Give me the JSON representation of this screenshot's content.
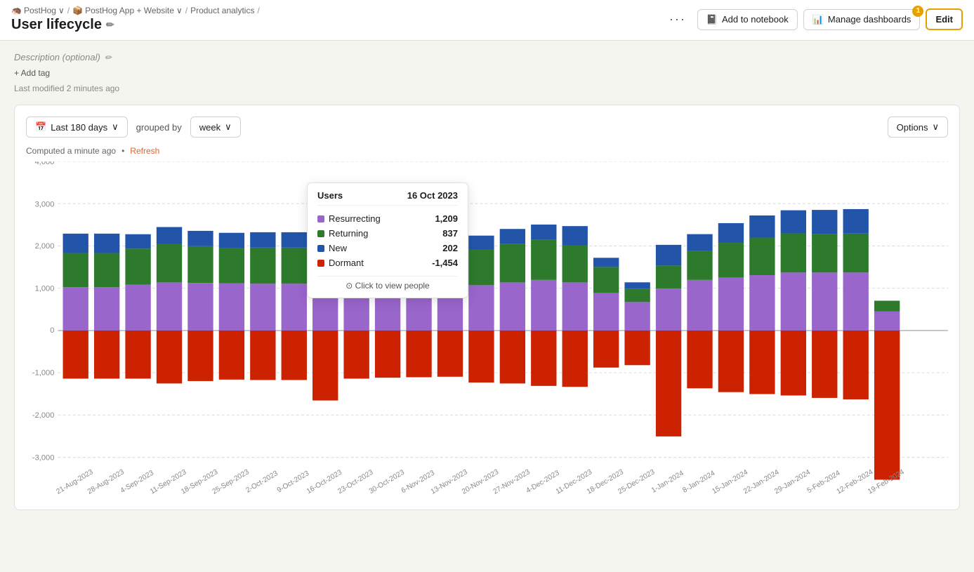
{
  "app": {
    "name": "PostHog",
    "workspace": "PostHog App + Website",
    "section": "Product analytics"
  },
  "header": {
    "title": "User lifecycle",
    "more_label": "···",
    "add_notebook_label": "Add to notebook",
    "manage_dashboards_label": "Manage dashboards",
    "manage_badge": "1",
    "edit_label": "Edit"
  },
  "page": {
    "description_placeholder": "Description (optional)",
    "add_tag_label": "+ Add tag",
    "last_modified": "Last modified 2 minutes ago"
  },
  "toolbar": {
    "date_range": "Last 180 days",
    "grouped_by_label": "grouped by",
    "group_value": "week",
    "options_label": "Options"
  },
  "chart": {
    "computed_label": "Computed a minute ago",
    "refresh_label": "Refresh",
    "y_labels": [
      "4,000",
      "3,000",
      "2,000",
      "1,000",
      "0",
      "-1,000",
      "-2,000",
      "-3,000"
    ],
    "x_labels": [
      "21-Aug-2023",
      "28-Aug-2023",
      "4-Sep-2023",
      "11-Sep-2023",
      "18-Sep-2023",
      "25-Sep-2023",
      "2-Oct-2023",
      "9-Oct-2023",
      "16-Oct-2023",
      "23-Oct-2023",
      "30-Oct-2023",
      "6-Nov-2023",
      "13-Nov-2023",
      "20-Nov-2023",
      "27-Nov-2023",
      "4-Dec-2023",
      "11-Dec-2023",
      "18-Dec-2023",
      "25-Dec-2023",
      "1-Jan-2024",
      "8-Jan-2024",
      "15-Jan-2024",
      "22-Jan-2024",
      "29-Jan-2024",
      "5-Feb-2024",
      "12-Feb-2024",
      "19-Feb-2024"
    ]
  },
  "tooltip": {
    "header_label": "Users",
    "date": "16 Oct 2023",
    "rows": [
      {
        "label": "Resurrecting",
        "value": "1,209",
        "color": "#9b59b6"
      },
      {
        "label": "Returning",
        "value": "837",
        "color": "#27ae60"
      },
      {
        "label": "New",
        "value": "202",
        "color": "#2980b9"
      },
      {
        "label": "Dormant",
        "value": "-1,454",
        "color": "#e74c3c"
      }
    ],
    "footer": "⊙ Click to view people"
  },
  "colors": {
    "resurrecting": "#9966cc",
    "returning": "#2d7a2d",
    "new": "#2255aa",
    "dormant": "#cc2200",
    "accent": "#e8a000"
  }
}
